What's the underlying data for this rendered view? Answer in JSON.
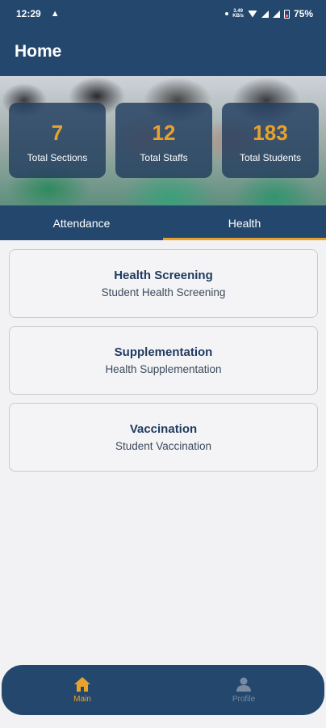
{
  "status_bar": {
    "time": "12:29",
    "network_speed_value": "3.49",
    "network_speed_unit": "KB/s",
    "battery": "75%"
  },
  "header": {
    "title": "Home"
  },
  "stats": [
    {
      "value": "7",
      "label": "Total Sections"
    },
    {
      "value": "12",
      "label": "Total Staffs"
    },
    {
      "value": "183",
      "label": "Total Students"
    }
  ],
  "tabs": [
    {
      "label": "Attendance",
      "active": false
    },
    {
      "label": "Health",
      "active": true
    }
  ],
  "cards": [
    {
      "title": "Health Screening",
      "subtitle": "Student Health Screening"
    },
    {
      "title": "Supplementation",
      "subtitle": "Health Supplementation"
    },
    {
      "title": "Vaccination",
      "subtitle": "Student Vaccination"
    }
  ],
  "bottom_nav": [
    {
      "label": "Main",
      "icon": "home-icon",
      "active": true
    },
    {
      "label": "Profile",
      "icon": "person-icon",
      "active": false
    }
  ],
  "colors": {
    "primary": "#24476e",
    "accent": "#e8a22c",
    "background": "#f2f2f4"
  }
}
